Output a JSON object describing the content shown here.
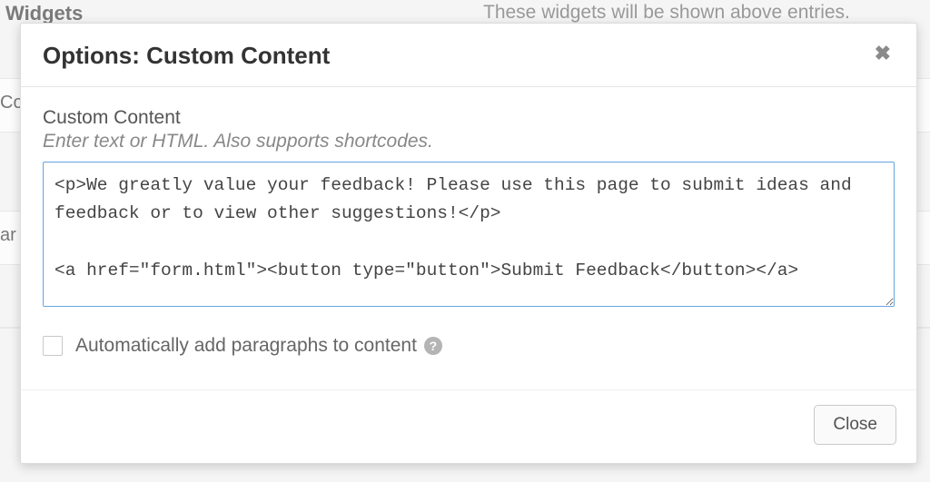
{
  "background": {
    "widgets_label": "Widgets",
    "widgets_desc": "These widgets will be shown above entries.",
    "left_fragment_co": "Co",
    "left_fragment_ar": "ar"
  },
  "modal": {
    "title": "Options: Custom Content",
    "field_label": "Custom Content",
    "field_help": "Enter text or HTML. Also supports shortcodes.",
    "textarea_value": "<p>We greatly value your feedback! Please use this page to submit ideas and feedback or to view other suggestions!</p>\n\n<a href=\"form.html\"><button type=\"button\">Submit Feedback</button></a>",
    "checkbox_label": "Automatically add paragraphs to content",
    "checkbox_checked": false,
    "help_icon_glyph": "?",
    "close_button_label": "Close",
    "close_icon_glyph": "✖"
  }
}
